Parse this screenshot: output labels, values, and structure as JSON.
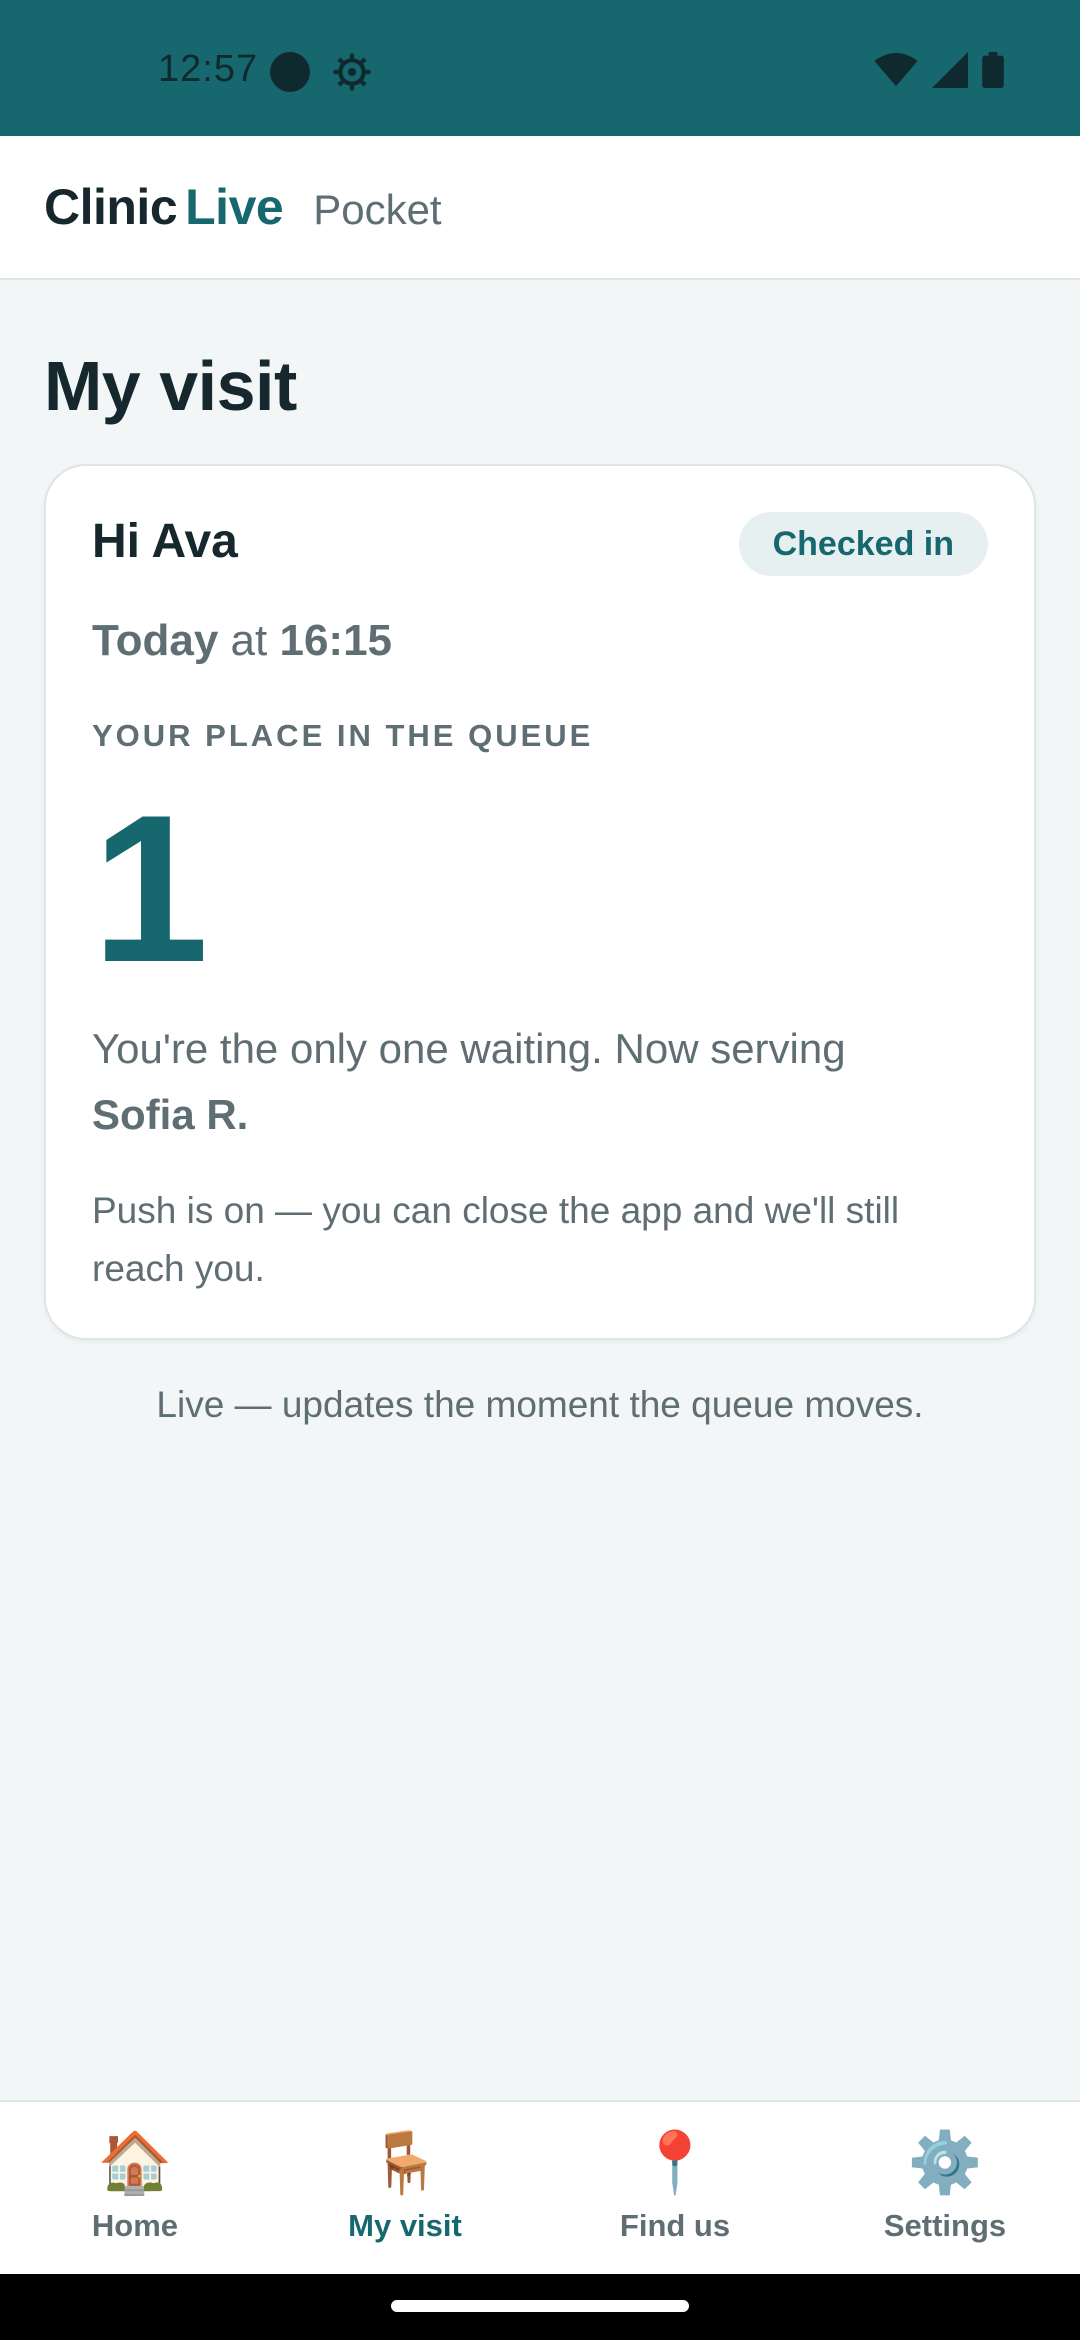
{
  "status_bar": {
    "time": "12:57",
    "icons": [
      "circle-icon",
      "gear-icon",
      "wifi-icon",
      "signal-icon",
      "battery-icon"
    ]
  },
  "header": {
    "brand_clinic": "Clinic",
    "brand_live": "Live",
    "brand_sub": "Pocket"
  },
  "page": {
    "title": "My visit"
  },
  "visit_card": {
    "greeting": "Hi Ava",
    "status_badge": "Checked in",
    "day": "Today",
    "at": "at",
    "time": "16:15",
    "queue_label": "YOUR PLACE IN THE QUEUE",
    "queue_position": "1",
    "serving_text": "You're the only one waiting. Now serving",
    "serving_name": "Sofia R.",
    "push_note": "Push is on — you can close the app and we'll still reach you."
  },
  "live_note": "Live — updates the moment the queue moves.",
  "bottom_nav": {
    "items": [
      {
        "label": "Home",
        "icon": "🏠",
        "icon_name": "house-icon"
      },
      {
        "label": "My visit",
        "icon": "🪑",
        "icon_name": "chair-icon",
        "active": true
      },
      {
        "label": "Find us",
        "icon": "📍",
        "icon_name": "pin-icon"
      },
      {
        "label": "Settings",
        "icon": "⚙️",
        "icon_name": "gear-icon"
      }
    ]
  },
  "colors": {
    "brand": "#17686e",
    "background": "#f2f6f7",
    "text": "#17272e",
    "muted": "#5e6e73"
  }
}
